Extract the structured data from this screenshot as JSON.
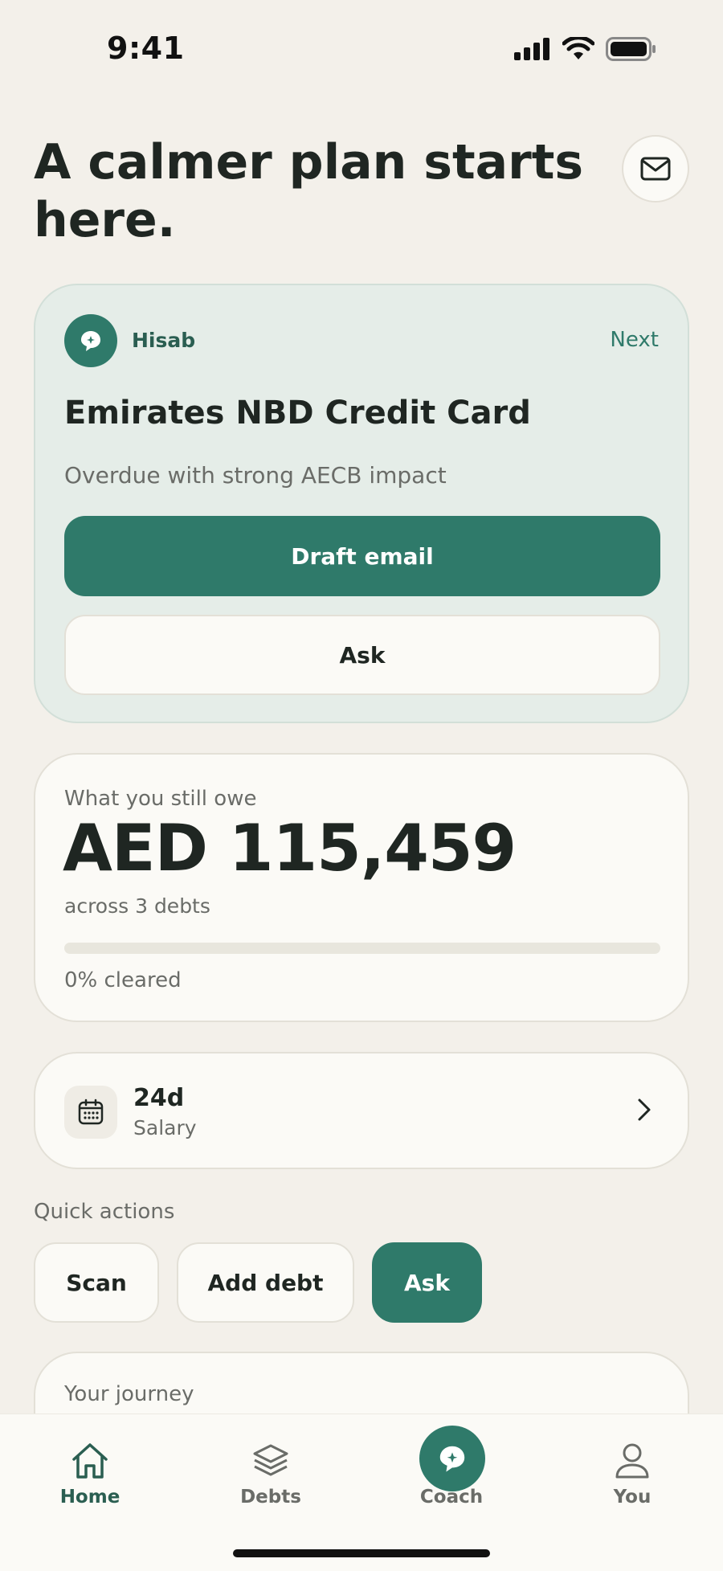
{
  "status_bar": {
    "time": "9:41",
    "icons": [
      "cellular-signal-icon",
      "wifi-icon",
      "battery-icon"
    ]
  },
  "header": {
    "title": "A calmer plan starts here.",
    "mail_icon": "envelope-icon"
  },
  "coach_card": {
    "name": "Hisab",
    "next_label": "Next",
    "title": "Emirates NBD Credit Card",
    "subtitle": "Overdue with strong AECB impact",
    "primary_action": "Draft email",
    "secondary_action": "Ask"
  },
  "owe_card": {
    "label": "What you still owe",
    "amount": "AED 115,459",
    "summary": "across 3 debts",
    "progress_fraction": 0,
    "progress_label": "0% cleared"
  },
  "salary_card": {
    "days": "24d",
    "label": "Salary",
    "icon": "calendar-icon"
  },
  "quick_actions": {
    "label": "Quick actions",
    "items": [
      "Scan",
      "Add debt",
      "Ask"
    ]
  },
  "journey": {
    "label": "Your journey"
  },
  "tab_bar": {
    "tabs": [
      {
        "label": "Home",
        "icon": "home-icon",
        "active": true
      },
      {
        "label": "Debts",
        "icon": "layers-icon",
        "active": false
      },
      {
        "label": "Coach",
        "icon": "chat-sparkle-icon",
        "active": false
      },
      {
        "label": "You",
        "icon": "person-icon",
        "active": false
      }
    ]
  },
  "colors": {
    "accent": "#2F7A6A",
    "background": "#F3F0EA",
    "card": "#FBFAF6",
    "coach_card": "#E5EDE8"
  }
}
